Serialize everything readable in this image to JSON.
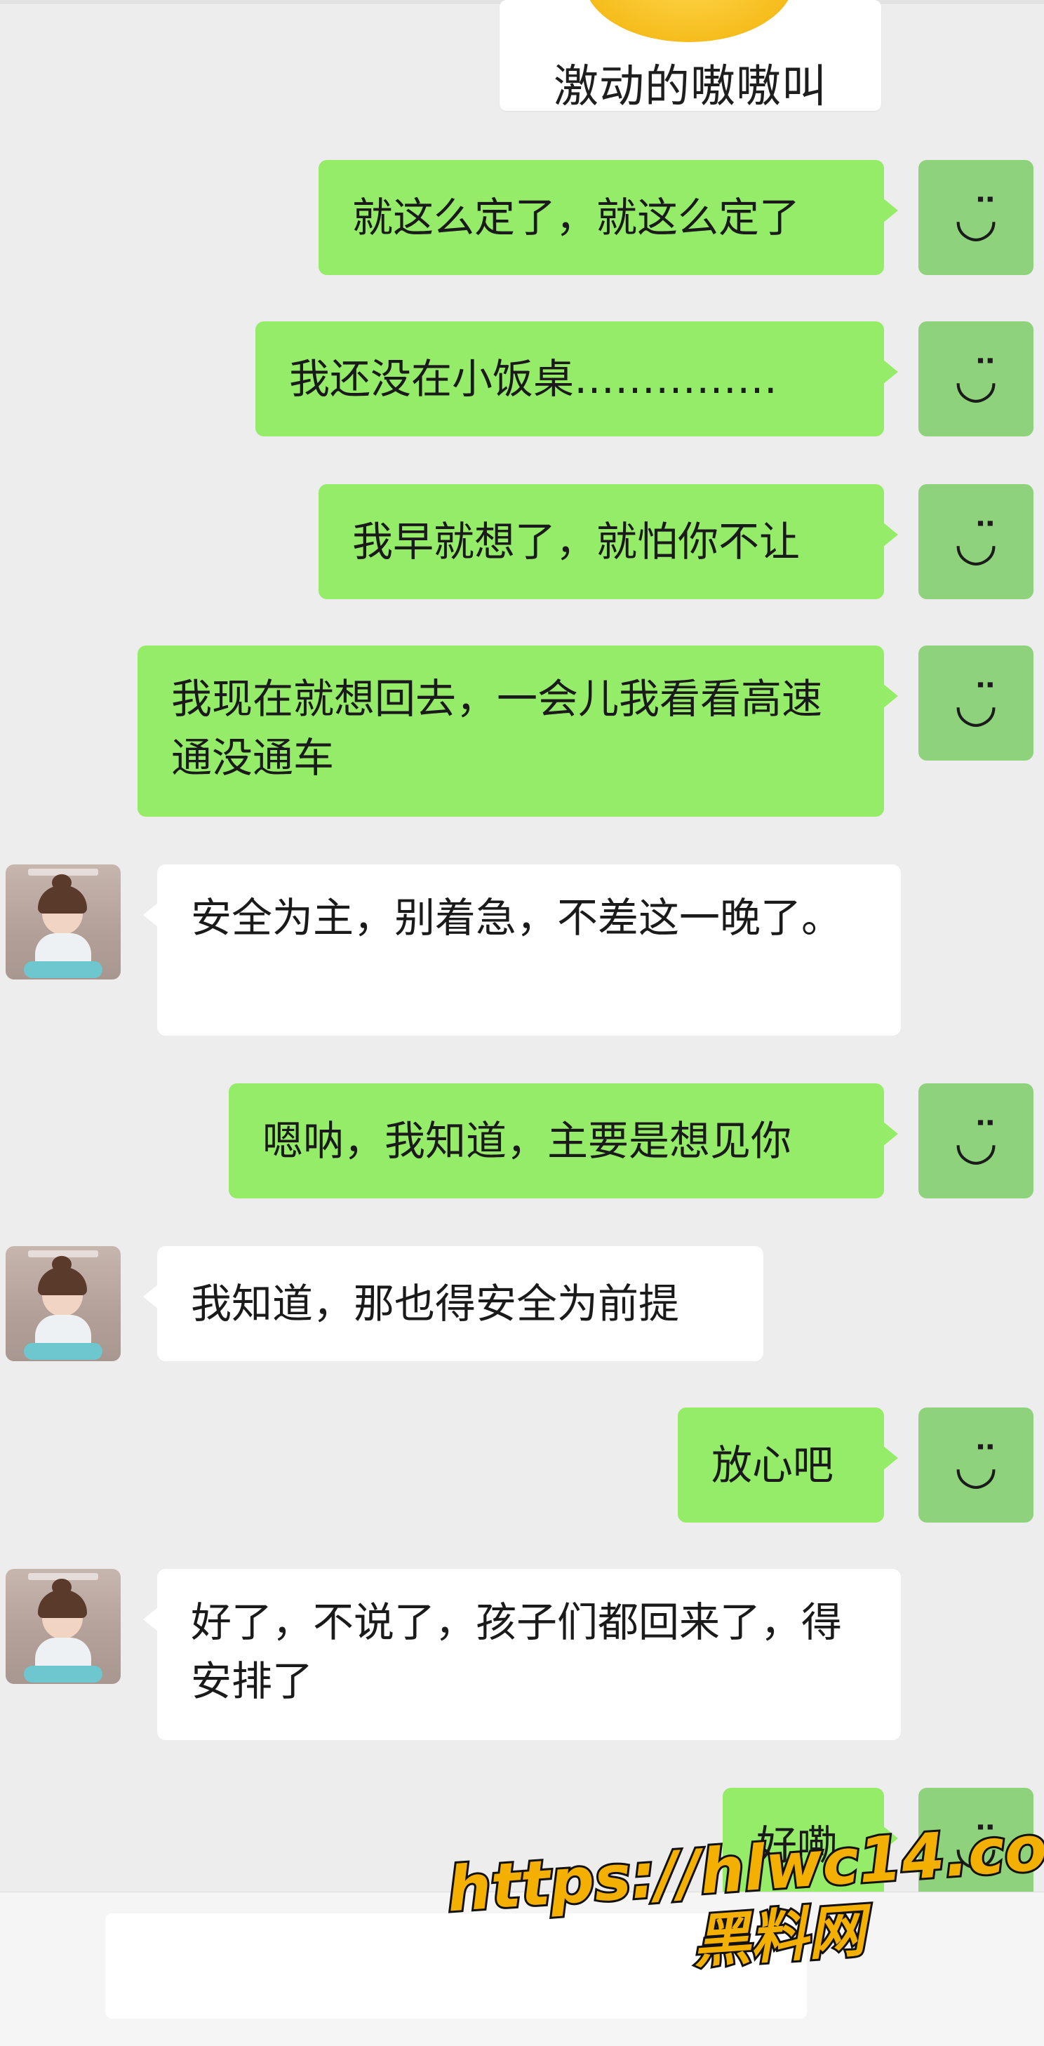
{
  "header": {
    "sticker_caption": "激动的嗷嗷叫"
  },
  "messages": [
    {
      "side": "me",
      "text": "就这么定了，就这么定了"
    },
    {
      "side": "me",
      "text": "我还没在小饭桌……………"
    },
    {
      "side": "me",
      "text": "我早就想了，就怕你不让"
    },
    {
      "side": "me",
      "text": "我现在就想回去，一会儿我看看高速通没通车"
    },
    {
      "side": "peer",
      "text": "安全为主，别着急，不差这一晚了。"
    },
    {
      "side": "me",
      "text": "嗯呐，我知道，主要是想见你"
    },
    {
      "side": "peer",
      "text": "我知道，那也得安全为前提"
    },
    {
      "side": "me",
      "text": "放心吧"
    },
    {
      "side": "peer",
      "text": "好了，不说了，孩子们都回来了，得安排了"
    },
    {
      "side": "me",
      "text": "好嘞"
    }
  ],
  "my_avatar_glyph": "◡̈",
  "watermark": {
    "url": "https://hlwc14.com",
    "site": "黑料网",
    "color": "#f4b000"
  },
  "colors": {
    "my_bubble": "#95ec69",
    "peer_bubble": "#ffffff",
    "background": "#ededed"
  }
}
